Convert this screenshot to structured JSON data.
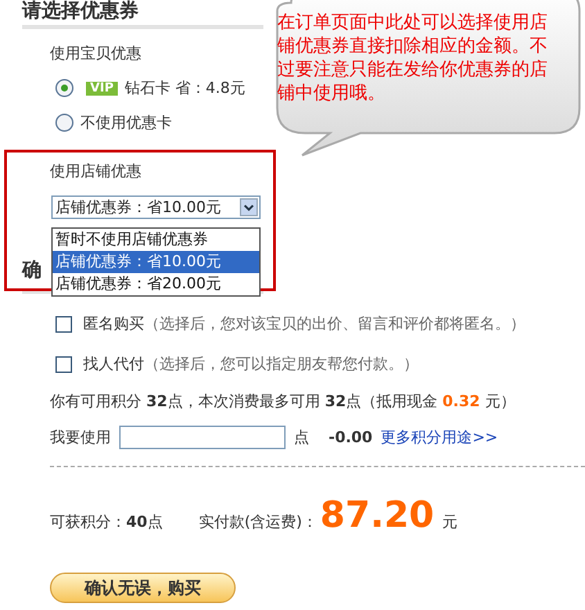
{
  "section_title": "请选择优惠券",
  "item_discount": {
    "label": "使用宝贝优惠",
    "options": [
      {
        "kind": "vip",
        "badge": "VIP",
        "label": "钻石卡 省：4.8元",
        "selected": true
      },
      {
        "kind": "plain",
        "label": "不使用优惠卡",
        "selected": false
      }
    ]
  },
  "shop_discount": {
    "label": "使用店铺优惠",
    "select_value": "店铺优惠券：省10.00元",
    "dropdown_options": [
      {
        "label": "暂时不使用店铺优惠券",
        "selected": false
      },
      {
        "label": "店铺优惠券：省10.00元",
        "selected": true
      },
      {
        "label": "店铺优惠券：省20.00元",
        "selected": false
      }
    ]
  },
  "confirm_title": "确",
  "options": [
    {
      "label": "匿名购买",
      "note": "（选择后，您对该宝贝的出价、留言和评价都将匿名。）",
      "checked": false
    },
    {
      "label": "找人代付",
      "note": "（选择后，您可以指定朋友帮您付款。）",
      "checked": false
    }
  ],
  "points": {
    "prefix": "你有可用积分",
    "available": "32",
    "mid": "点，本次消费最多可用",
    "max": "32",
    "suffix_a": "点（抵用现金",
    "cash": "0.32",
    "suffix_b": "元）"
  },
  "use_points": {
    "label": "我要使用",
    "unit": "点",
    "deduction": "-0.00",
    "link": "更多积分用途>>"
  },
  "summary": {
    "earn_label": "可获积分：",
    "earn_value": "40",
    "earn_unit": "点",
    "pay_label": "实付款(含运费)：",
    "pay_value": "87.20",
    "pay_unit": "元"
  },
  "submit": "确认无误，购买",
  "callout": "在订单页面中此处可以选择使用店铺优惠券直接扣除相应的金额。不过要注意只能在发给你优惠券的店铺中使用哦。"
}
